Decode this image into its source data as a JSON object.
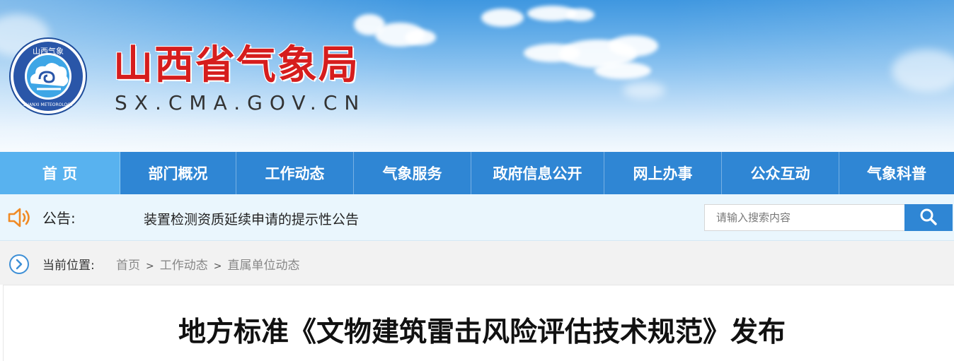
{
  "header": {
    "site_name": "山西省气象局",
    "site_domain": "SX.CMA.GOV.CN",
    "logo": {
      "top_text": "山西气象",
      "bottom_text": "SHANXI METEOROLOGY",
      "icon": "cloud-swirl-emblem"
    }
  },
  "nav": {
    "items": [
      {
        "label": "首 页",
        "active": true
      },
      {
        "label": "部门概况",
        "active": false
      },
      {
        "label": "工作动态",
        "active": false
      },
      {
        "label": "气象服务",
        "active": false
      },
      {
        "label": "政府信息公开",
        "active": false
      },
      {
        "label": "网上办事",
        "active": false
      },
      {
        "label": "公众互动",
        "active": false
      },
      {
        "label": "气象科普",
        "active": false
      }
    ]
  },
  "notice": {
    "icon": "speaker-icon",
    "label": "公告:",
    "text": "装置检测资质延续申请的提示性公告"
  },
  "search": {
    "placeholder": "请输入搜索内容",
    "icon": "search-icon"
  },
  "breadcrumb": {
    "icon": "chevron-right-circle-icon",
    "label": "当前位置:",
    "items": [
      "首页",
      "工作动态",
      "直属单位动态"
    ],
    "separator": ">"
  },
  "article": {
    "title": "地方标准《文物建筑雷击风险评估技术规范》发布"
  },
  "colors": {
    "nav_bg": "#2f86d4",
    "nav_active_bg": "#58b2ef",
    "site_name": "#d61d1d",
    "notice_bg": "#eaf6fd",
    "speaker": "#f08a24",
    "breadcrumb_bg": "#f2f2f2"
  }
}
